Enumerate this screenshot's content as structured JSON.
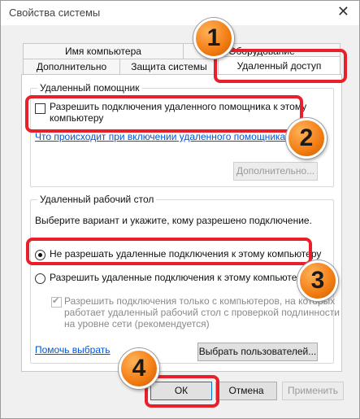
{
  "window": {
    "title": "Свойства системы",
    "close_glyph": "✕"
  },
  "tabs": {
    "row1": [
      "Имя компьютера",
      "Оборудование"
    ],
    "row2": [
      "Дополнительно",
      "Защита системы",
      "Удаленный доступ"
    ],
    "active": "Удаленный доступ"
  },
  "remote_assistance": {
    "group_title": "Удаленный помощник",
    "checkbox_label_line1": "Разрешить подключения удаленного помощника к этому",
    "checkbox_label_line2": "компьютеру",
    "checked": false,
    "help_link": "Что происходит при включении удаленного помощника?",
    "advanced_button": "Дополнительно..."
  },
  "remote_desktop": {
    "group_title": "Удаленный рабочий стол",
    "instruction": "Выберите вариант и укажите, кому разрешено подключение.",
    "option_deny": "Не разрешать удаленные подключения к этому компьютеру",
    "option_allow": "Разрешить удаленные подключения к этому компьютеру",
    "selected": "deny",
    "nla_line1": "Разрешить подключения только с компьютеров, на которых",
    "nla_line2": "работает удаленный рабочий стол с проверкой подлинности",
    "nla_line3": "на уровне сети (рекомендуется)",
    "nla_checked": true,
    "help_link": "Помочь выбрать",
    "select_users_button": "Выбрать пользователей..."
  },
  "footer": {
    "ok": "ОК",
    "cancel": "Отмена",
    "apply": "Применить"
  },
  "markers": [
    "1",
    "2",
    "3",
    "4"
  ],
  "colors": {
    "highlight": "#e8202a",
    "marker": "#f27c12",
    "link": "#0056d6"
  }
}
